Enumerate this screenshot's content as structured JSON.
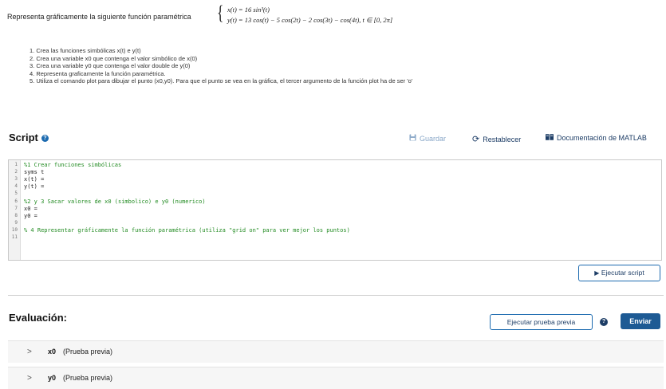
{
  "problem": {
    "intro": "Representa gráficamente la siguiente función paramétrica",
    "eq_x": "x(t) = 16 sin³(t)",
    "eq_y": "y(t) = 13 cos(t) − 5 cos(2t) − 2 cos(3t) − cos(4t), t ∈ [0, 2π]",
    "steps": [
      "1. Crea las funciones simbólicas x(t) e y(t)",
      "2. Crea una variable x0 que contenga el valor simbólico de x(0)",
      "3. Crea una variable y0 que contenga el valor double de y(0)",
      "4. Representa graficamente la función paramétrica.",
      "5. Utiliza el comando plot para dibujar el punto (x0,y0). Para que el punto se vea en la gráfica, el tercer argumento de la función plot ha de ser 'o'"
    ]
  },
  "script": {
    "title": "Script",
    "help_icon": "?",
    "save_label": "Guardar",
    "reset_label": "Restablecer",
    "doc_label": "Documentación de MATLAB",
    "run_label": "Ejecutar script",
    "lines": [
      {
        "n": "1",
        "text": "%1 Crear funciones simbólicas",
        "type": "cmt"
      },
      {
        "n": "2",
        "text": "syms t",
        "type": "kw"
      },
      {
        "n": "3",
        "text": "x(t) =",
        "type": "kw"
      },
      {
        "n": "4",
        "text": "y(t) =",
        "type": "kw"
      },
      {
        "n": "5",
        "text": "",
        "type": "kw"
      },
      {
        "n": "6",
        "text": "%2 y 3 Sacar valores de x0 (simbolico) e y0 (numerico)",
        "type": "cmt"
      },
      {
        "n": "7",
        "text": "x0 =",
        "type": "kw"
      },
      {
        "n": "8",
        "text": "y0 =",
        "type": "kw"
      },
      {
        "n": "9",
        "text": "",
        "type": "kw"
      },
      {
        "n": "10",
        "text": "% 4 Representar gráficamente la función paramétrica (utiliza \"grid on\" para ver mejor los puntos)",
        "type": "cmt"
      },
      {
        "n": "11",
        "text": "",
        "type": "kw"
      }
    ]
  },
  "evaluation": {
    "title": "Evaluación:",
    "preview_label": "Ejecutar prueba previa",
    "help_icon": "?",
    "submit_label": "Enviar",
    "tests": [
      {
        "var": "x0",
        "note": "(Prueba previa)"
      },
      {
        "var": "y0",
        "note": "(Prueba previa)"
      }
    ]
  },
  "colors": {
    "accent": "#1d5a94",
    "comment": "#228b22"
  }
}
